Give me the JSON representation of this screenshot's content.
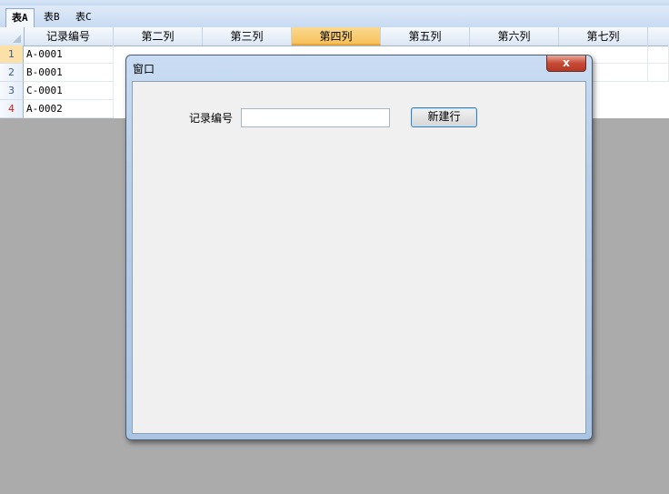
{
  "sheet_tabs": [
    {
      "label": "表A",
      "active": true
    },
    {
      "label": "表B",
      "active": false
    },
    {
      "label": "表C",
      "active": false
    }
  ],
  "grid": {
    "column_headers": [
      "记录编号",
      "第二列",
      "第三列",
      "第四列",
      "第五列",
      "第六列",
      "第七列"
    ],
    "selected_column": "第四列",
    "rows": [
      {
        "num": "1",
        "id": "A-0001"
      },
      {
        "num": "2",
        "id": "B-0001"
      },
      {
        "num": "3",
        "id": "C-0001"
      },
      {
        "num": "4",
        "id": "A-0002"
      }
    ]
  },
  "dialog": {
    "title": "窗口",
    "close_label": "x",
    "field_label": "记录编号",
    "field_value": "",
    "button_label": "新建行"
  },
  "colors": {
    "selected_column": "#f6c15b",
    "row4_number": "#d21a1a",
    "desktop_bg": "#ababab"
  }
}
